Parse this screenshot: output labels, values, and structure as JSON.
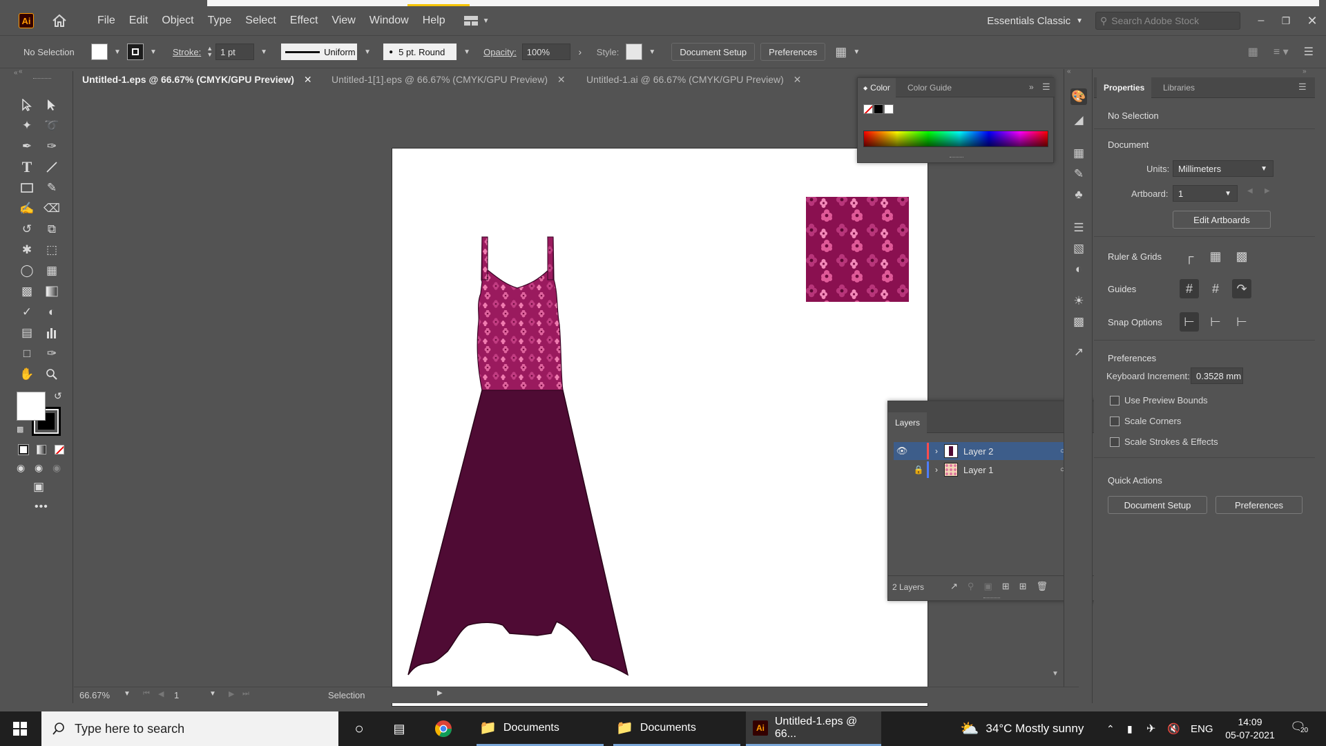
{
  "menubar": {
    "logo": "Ai",
    "items": [
      "File",
      "Edit",
      "Object",
      "Type",
      "Select",
      "Effect",
      "View",
      "Window",
      "Help"
    ],
    "workspace": "Essentials Classic",
    "search_placeholder": "Search Adobe Stock"
  },
  "controlbar": {
    "selection": "No Selection",
    "stroke_label": "Stroke:",
    "stroke_value": "1 pt",
    "profile": "Uniform",
    "brush": "5 pt. Round",
    "opacity_label": "Opacity:",
    "opacity_value": "100%",
    "style_label": "Style:",
    "document_setup": "Document Setup",
    "preferences": "Preferences"
  },
  "tabs": [
    {
      "label": "Untitled-1.eps @ 66.67% (CMYK/GPU Preview)"
    },
    {
      "label": "Untitled-1[1].eps @ 66.67% (CMYK/GPU Preview)"
    },
    {
      "label": "Untitled-1.ai @ 66.67% (CMYK/GPU Preview)"
    }
  ],
  "color_panel": {
    "tab_color": "Color",
    "tab_guide": "Color Guide"
  },
  "layers_panel": {
    "title": "Layers",
    "layers": [
      {
        "name": "Layer 2",
        "color": "#ff4d4d"
      },
      {
        "name": "Layer 1",
        "color": "#4d7dff"
      }
    ],
    "count": "2 Layers"
  },
  "properties": {
    "tab_properties": "Properties",
    "tab_libraries": "Libraries",
    "selection": "No Selection",
    "document": "Document",
    "units_label": "Units:",
    "units_value": "Millimeters",
    "artboard_label": "Artboard:",
    "artboard_value": "1",
    "edit_artboards": "Edit Artboards",
    "ruler_grids": "Ruler & Grids",
    "guides": "Guides",
    "snap_options": "Snap Options",
    "preferences": "Preferences",
    "keyboard_increment_label": "Keyboard Increment:",
    "keyboard_increment_value": "0.3528 mm",
    "use_preview_bounds": "Use Preview Bounds",
    "scale_corners": "Scale Corners",
    "scale_strokes": "Scale Strokes & Effects",
    "quick_actions": "Quick Actions",
    "qa_document_setup": "Document Setup",
    "qa_preferences": "Preferences"
  },
  "statusbar": {
    "zoom": "66.67%",
    "artboard": "1",
    "tool": "Selection"
  },
  "taskbar": {
    "search_placeholder": "Type here to search",
    "app1": "Documents",
    "app2": "Documents",
    "app3": "Untitled-1.eps @ 66...",
    "weather": "34°C  Mostly sunny",
    "lang": "ENG",
    "time": "14:09",
    "date": "05-07-2021",
    "notifications": "20"
  },
  "colors": {
    "dress_bottom": "#4f0b34",
    "dress_top": "#c8307a",
    "pattern_bg": "#8a1050"
  }
}
